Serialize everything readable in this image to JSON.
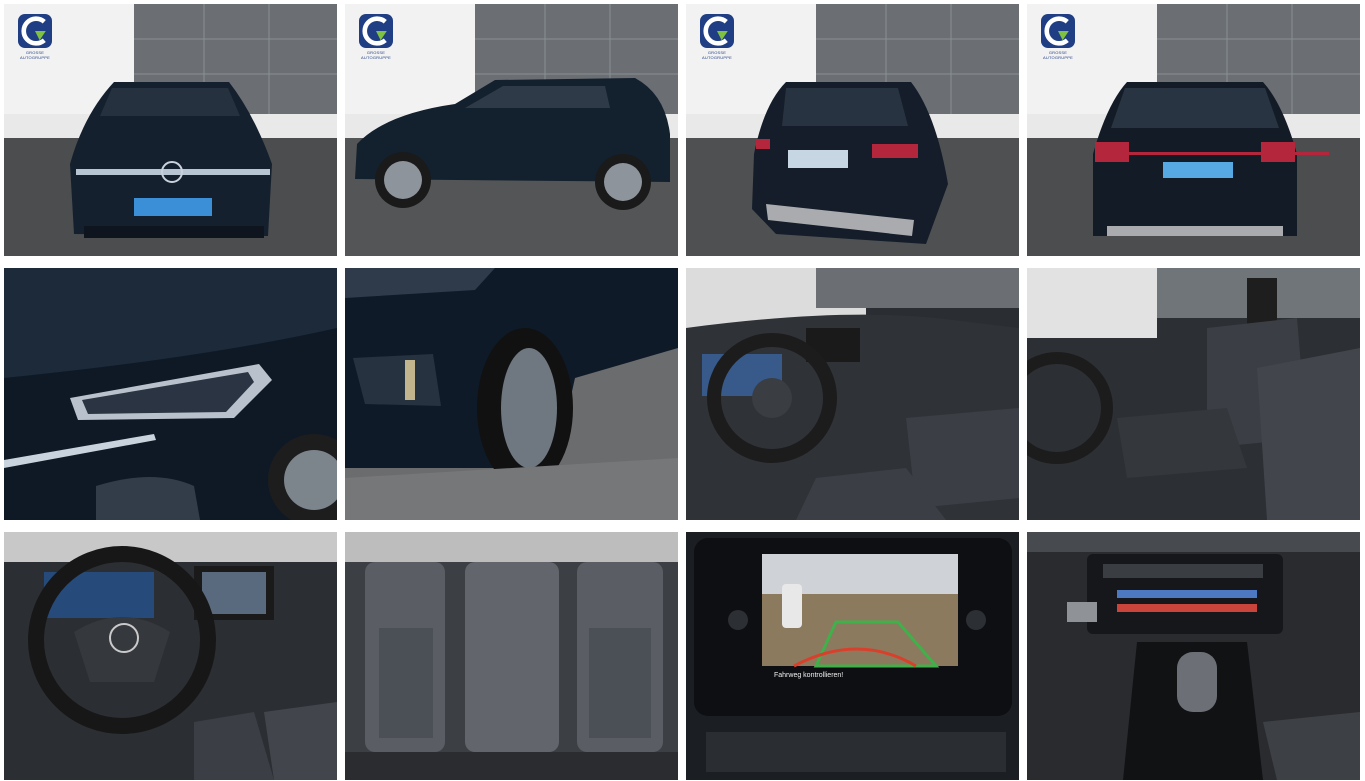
{
  "gallery": {
    "dealer_logo": {
      "icon": "dealer-logo-icon",
      "subtext": "GROSSE AUTOGRUPPE",
      "brand_color": "#1f3e83"
    },
    "photos": [
      {
        "id": "front-exterior",
        "icon": "car-front-icon"
      },
      {
        "id": "side-exterior",
        "icon": "car-side-icon"
      },
      {
        "id": "rear-three-quarter",
        "icon": "car-rear-icon"
      },
      {
        "id": "rear-exterior",
        "icon": "car-rear-icon"
      },
      {
        "id": "headlight-detail",
        "icon": "headlight-icon"
      },
      {
        "id": "wheel-detail",
        "icon": "wheel-icon"
      },
      {
        "id": "interior-cockpit",
        "icon": "steering-wheel-icon"
      },
      {
        "id": "front-seats",
        "icon": "seat-icon"
      },
      {
        "id": "dashboard-steering",
        "icon": "steering-wheel-icon"
      },
      {
        "id": "rear-seats",
        "icon": "seat-icon"
      },
      {
        "id": "infotainment-rear-camera",
        "icon": "screen-icon",
        "warning_text": "Fahrweg kontrollieren!"
      },
      {
        "id": "center-console",
        "icon": "gear-shift-icon"
      }
    ]
  }
}
